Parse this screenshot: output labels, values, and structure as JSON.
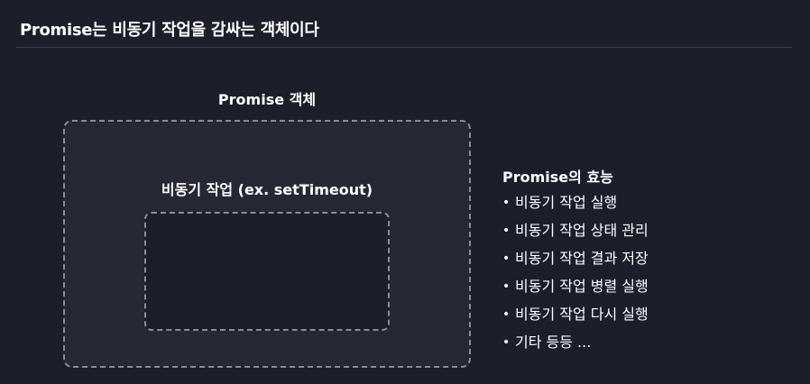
{
  "header": {
    "title": "Promise는 비동기 작업을 감싸는 객체이다"
  },
  "diagram": {
    "outer_label": "Promise 객체",
    "inner_label": "비동기 작업 (ex. setTimeout)"
  },
  "effects": {
    "title": "Promise의 효능",
    "bullet": "•",
    "items": [
      "비동기 작업 실행",
      "비동기 작업 상태 관리",
      "비동기 작업 결과 저장",
      "비동기 작업 병렬 실행",
      "비동기 작업 다시 실행",
      "기타 등등 ..."
    ]
  },
  "colors": {
    "background": "#1d1e2a",
    "outer_box_fill": "#272834",
    "dashed_border": "#8a8c96",
    "text": "#ffffff"
  }
}
